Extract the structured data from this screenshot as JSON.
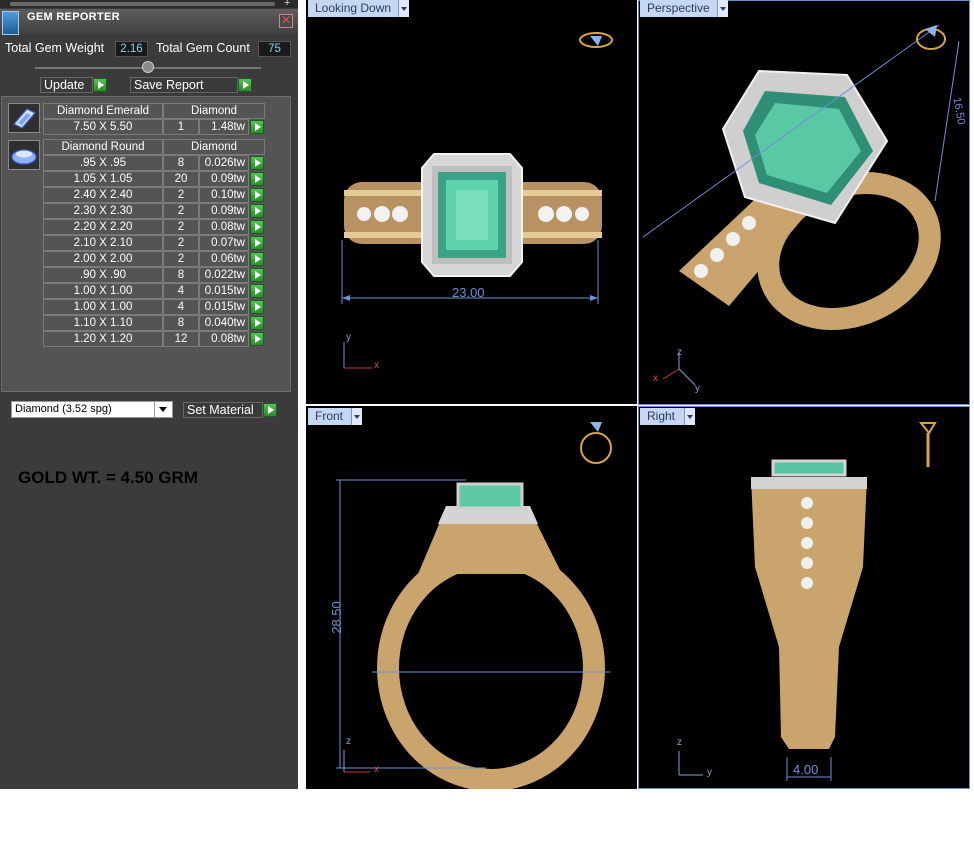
{
  "panel": {
    "title": "GEM REPORTER",
    "total_weight_label": "Total Gem Weight",
    "total_weight_value": "2.16",
    "total_count_label": "Total Gem Count",
    "total_count_value": "75",
    "update_label": "Update",
    "save_report_label": "Save Report",
    "groups": [
      {
        "shape": "Diamond Emerald",
        "material": "Diamond",
        "rows": [
          {
            "size": "7.50 X 5.50",
            "count": "1",
            "weight": "1.48tw"
          }
        ]
      },
      {
        "shape": "Diamond Round",
        "material": "Diamond",
        "rows": [
          {
            "size": ".95 X .95",
            "count": "8",
            "weight": "0.026tw"
          },
          {
            "size": "1.05 X 1.05",
            "count": "20",
            "weight": "0.09tw"
          },
          {
            "size": "2.40 X 2.40",
            "count": "2",
            "weight": "0.10tw"
          },
          {
            "size": "2.30 X 2.30",
            "count": "2",
            "weight": "0.09tw"
          },
          {
            "size": "2.20 X 2.20",
            "count": "2",
            "weight": "0.08tw"
          },
          {
            "size": "2.10 X 2.10",
            "count": "2",
            "weight": "0.07tw"
          },
          {
            "size": "2.00 X 2.00",
            "count": "2",
            "weight": "0.06tw"
          },
          {
            "size": ".90 X .90",
            "count": "8",
            "weight": "0.022tw"
          },
          {
            "size": "1.00 X 1.00",
            "count": "4",
            "weight": "0.015tw"
          },
          {
            "size": "1.00 X 1.00",
            "count": "4",
            "weight": "0.015tw"
          },
          {
            "size": "1.10 X 1.10",
            "count": "8",
            "weight": "0.040tw"
          },
          {
            "size": "1.20 X 1.20",
            "count": "12",
            "weight": "0.08tw"
          }
        ]
      }
    ],
    "material_select": "Diamond    (3.52 spg)",
    "set_material_label": "Set Material",
    "note": "GOLD WT. = 4.50 GRM"
  },
  "viewports": {
    "top_left": {
      "label": "Looking Down",
      "dimension": "23.00",
      "axis_1": "y",
      "axis_2": "x"
    },
    "top_right": {
      "label": "Perspective",
      "dimension": "16.50",
      "axis_1": "z",
      "axis_2": "x",
      "axis_3": "y"
    },
    "bottom_left": {
      "label": "Front",
      "dimension": "28.50",
      "axis_1": "z",
      "axis_2": "x"
    },
    "bottom_right": {
      "label": "Right",
      "dimension": "4.00",
      "axis_1": "z",
      "axis_2": "y"
    }
  },
  "colors": {
    "gold": "#c9a46c",
    "emerald": "#49c7a4",
    "dimension": "#6f8fd6",
    "tab": "#c6d7f3",
    "panel": "#3b3b3b"
  }
}
